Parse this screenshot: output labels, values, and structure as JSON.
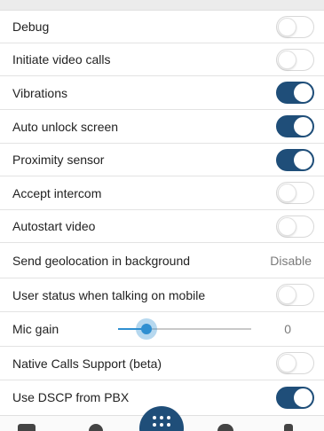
{
  "settings": {
    "debug": {
      "label": "Debug",
      "on": false
    },
    "initiate_video_calls": {
      "label": "Initiate video calls",
      "on": false
    },
    "vibrations": {
      "label": "Vibrations",
      "on": true
    },
    "auto_unlock_screen": {
      "label": "Auto unlock screen",
      "on": true
    },
    "proximity_sensor": {
      "label": "Proximity sensor",
      "on": true
    },
    "accept_intercom": {
      "label": "Accept intercom",
      "on": false
    },
    "autostart_video": {
      "label": "Autostart video",
      "on": false
    },
    "send_geolocation": {
      "label": "Send geolocation in background",
      "value": "Disable"
    },
    "user_status_mobile": {
      "label": "User status when talking on mobile",
      "on": false
    },
    "mic_gain": {
      "label": "Mic gain",
      "value": "0"
    },
    "native_calls_support": {
      "label": "Native Calls Support (beta)",
      "on": false
    },
    "use_dscp_pbx": {
      "label": "Use DSCP from PBX",
      "on": true
    }
  },
  "colors": {
    "toggle_on": "#1f4e79",
    "slider_accent": "#2f8fd1"
  },
  "icons": {
    "fab": "dialpad-icon"
  }
}
